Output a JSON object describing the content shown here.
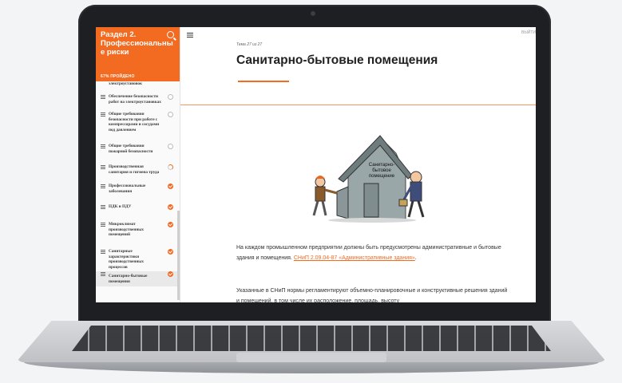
{
  "sidebar": {
    "title": "Раздел 2. Профессиональны е риски",
    "progress_label": "67% ПРОЙДЕНО",
    "items": [
      {
        "label": "электроустановок",
        "status": "none"
      },
      {
        "label": "Обеспечение безопасности работ на электроустановках",
        "status": "empty"
      },
      {
        "label": "Общие требования безопасности при работе с компрессорами и сосудами под давлением",
        "status": "empty"
      },
      {
        "label": "Общие требования пожарной безопасности",
        "status": "empty"
      },
      {
        "label": "Производственная санитария и гигиена труда",
        "status": "partial"
      },
      {
        "label": "Профессиональные заболевания",
        "status": "done"
      },
      {
        "label": "ПДК и ПДУ",
        "status": "done"
      },
      {
        "label": "Микроклимат производственных помещений",
        "status": "done"
      },
      {
        "label": "Санитарные характеристики производственных процессов",
        "status": "done"
      },
      {
        "label": "Санитарно-бытовые помещения",
        "status": "done"
      }
    ]
  },
  "main": {
    "exit_label": "ВЫЙТИ",
    "lesson_count": "Тема 27 из 27",
    "title": "Санитарно-бытовые помещения",
    "illustration_sign": [
      "Санитарно-",
      "бытовое",
      "помещение"
    ],
    "para1_text": "На каждом промышленном предприятии должны быть предусмотрены административные и бытовые здания и помещения. ",
    "para1_link": "СНиП 2.09.04-87 «Административные здания»",
    "para1_end": ".",
    "para2_text": "Указанные в СНиП нормы регламентируют объемно-планировочные и конструктивные решения зданий и помещений, в том числе их расположение, площадь, высоту"
  },
  "colors": {
    "accent": "#f36a21",
    "sidebar_bg": "#fafafa"
  }
}
